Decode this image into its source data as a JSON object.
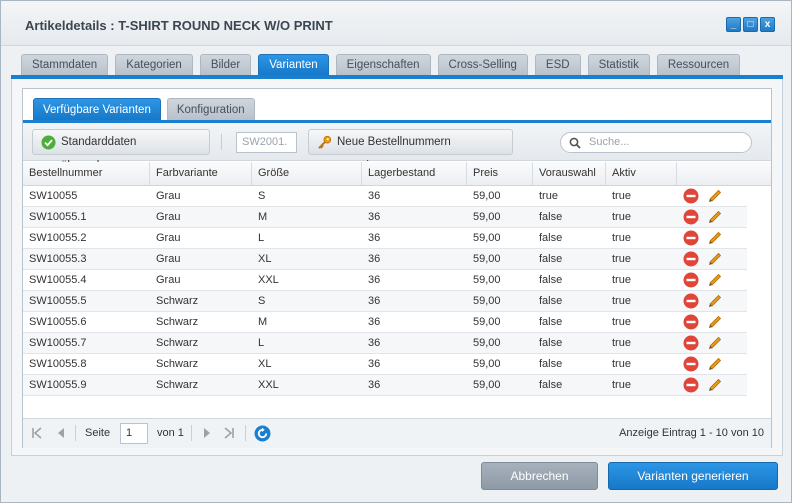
{
  "window": {
    "title": "Artikeldetails : T-SHIRT ROUND NECK W/O PRINT",
    "controls": {
      "minimize": "_",
      "maximize": "□",
      "close": "x"
    }
  },
  "tabs": [
    {
      "label": "Stammdaten"
    },
    {
      "label": "Kategorien"
    },
    {
      "label": "Bilder"
    },
    {
      "label": "Varianten",
      "active": true
    },
    {
      "label": "Eigenschaften"
    },
    {
      "label": "Cross-Selling"
    },
    {
      "label": "ESD"
    },
    {
      "label": "Statistik"
    },
    {
      "label": "Ressourcen"
    }
  ],
  "subtabs": [
    {
      "label": "Verfügbare Varianten",
      "active": true
    },
    {
      "label": "Konfiguration"
    }
  ],
  "toolbar": {
    "apply_defaults_label": "Standarddaten übernehmen",
    "number_prefix_value": "SW2001.",
    "generate_numbers_label": "Neue Bestellnummern generieren",
    "search_placeholder": "Suche..."
  },
  "grid": {
    "columns": [
      "Bestellnummer",
      "Farbvariante",
      "Größe",
      "Lagerbestand",
      "Preis",
      "Vorauswahl",
      "Aktiv"
    ],
    "rows": [
      [
        "SW10055",
        "Grau",
        "S",
        "36",
        "59,00",
        "true",
        "true"
      ],
      [
        "SW10055.1",
        "Grau",
        "M",
        "36",
        "59,00",
        "false",
        "true"
      ],
      [
        "SW10055.2",
        "Grau",
        "L",
        "36",
        "59,00",
        "false",
        "true"
      ],
      [
        "SW10055.3",
        "Grau",
        "XL",
        "36",
        "59,00",
        "false",
        "true"
      ],
      [
        "SW10055.4",
        "Grau",
        "XXL",
        "36",
        "59,00",
        "false",
        "true"
      ],
      [
        "SW10055.5",
        "Schwarz",
        "S",
        "36",
        "59,00",
        "false",
        "true"
      ],
      [
        "SW10055.6",
        "Schwarz",
        "M",
        "36",
        "59,00",
        "false",
        "true"
      ],
      [
        "SW10055.7",
        "Schwarz",
        "L",
        "36",
        "59,00",
        "false",
        "true"
      ],
      [
        "SW10055.8",
        "Schwarz",
        "XL",
        "36",
        "59,00",
        "false",
        "true"
      ],
      [
        "SW10055.9",
        "Schwarz",
        "XXL",
        "36",
        "59,00",
        "false",
        "true"
      ]
    ],
    "row_icons": [
      "delete-icon",
      "edit-icon"
    ]
  },
  "pager": {
    "page_label": "Seite",
    "page_value": "1",
    "of_label": "von 1",
    "display_info": "Anzeige Eintrag 1 - 10 von 10"
  },
  "footer": {
    "cancel_label": "Abbrechen",
    "generate_label": "Varianten generieren"
  },
  "colors": {
    "accent": "#1b7fd0",
    "delete_red": "#e0453a",
    "edit_orange": "#e89a1a",
    "check_green": "#4caf3a"
  }
}
